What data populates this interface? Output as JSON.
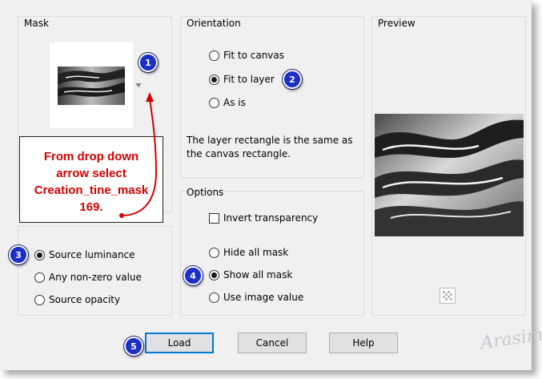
{
  "mask": {
    "title": "Mask",
    "thumbnail_icon": "flames-mask-thumbnail",
    "dropdown_icon": "dropdown-arrow-icon",
    "source_options": [
      {
        "label": "Source luminance",
        "selected": true
      },
      {
        "label": "Any non-zero value",
        "selected": false
      },
      {
        "label": "Source opacity",
        "selected": false
      }
    ]
  },
  "orientation": {
    "title": "Orientation",
    "options": [
      {
        "label": "Fit to canvas",
        "selected": false
      },
      {
        "label": "Fit to layer",
        "selected": true
      },
      {
        "label": "As is",
        "selected": false
      }
    ],
    "description": "The layer rectangle is the same as the canvas rectangle."
  },
  "options": {
    "title": "Options",
    "invert_transparency": {
      "label": "Invert transparency",
      "checked": false
    },
    "mask_options": [
      {
        "label": "Hide all mask",
        "selected": false
      },
      {
        "label": "Show all mask",
        "selected": true
      },
      {
        "label": "Use image value",
        "selected": false
      }
    ]
  },
  "preview": {
    "title": "Preview",
    "image_icon": "flames-preview-image",
    "transparency_icon": "checkerboard-icon"
  },
  "buttons": {
    "load": "Load",
    "cancel": "Cancel",
    "help": "Help"
  },
  "annotation": {
    "callout_lines": [
      "From drop down",
      "arrow select",
      "Creation_tine_mask",
      "169."
    ],
    "badges": [
      "1",
      "2",
      "3",
      "4",
      "5"
    ],
    "color": "#d40000",
    "badge_color": "#1d2fc9"
  },
  "watermark": "Arasimo"
}
